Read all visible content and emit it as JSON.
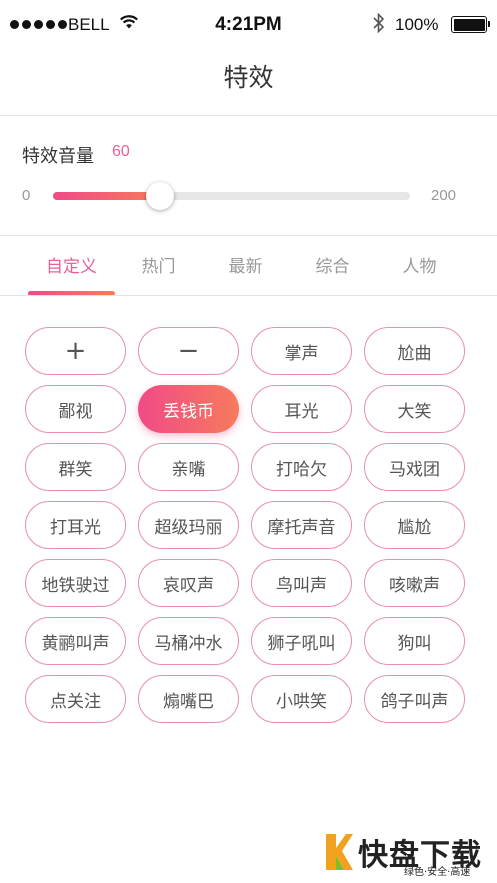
{
  "status_bar": {
    "carrier": "BELL",
    "time": "4:21PM",
    "battery": "100%",
    "signal_bars": 5
  },
  "nav": {
    "title": "特效"
  },
  "volume": {
    "label": "特效音量",
    "value": "60",
    "min": "0",
    "max": "200",
    "level": 60,
    "range_max": 200
  },
  "tabs": [
    {
      "label": "自定义",
      "active": true
    },
    {
      "label": "热门",
      "active": false
    },
    {
      "label": "最新",
      "active": false
    },
    {
      "label": "综合",
      "active": false
    },
    {
      "label": "人物",
      "active": false
    }
  ],
  "effects": [
    {
      "label": "+",
      "kind": "add"
    },
    {
      "label": "−",
      "kind": "remove"
    },
    {
      "label": "掌声"
    },
    {
      "label": "尬曲"
    },
    {
      "label": "鄙视"
    },
    {
      "label": "丢钱币",
      "selected": true
    },
    {
      "label": "耳光"
    },
    {
      "label": "大笑"
    },
    {
      "label": "群笑"
    },
    {
      "label": "亲嘴"
    },
    {
      "label": "打哈欠"
    },
    {
      "label": "马戏团"
    },
    {
      "label": "打耳光"
    },
    {
      "label": "超级玛丽"
    },
    {
      "label": "摩托声音"
    },
    {
      "label": "尴尬"
    },
    {
      "label": "地铁驶过"
    },
    {
      "label": "哀叹声"
    },
    {
      "label": "鸟叫声"
    },
    {
      "label": "咳嗽声"
    },
    {
      "label": "黄鹂叫声"
    },
    {
      "label": "马桶冲水"
    },
    {
      "label": "狮子吼叫"
    },
    {
      "label": "狗叫"
    },
    {
      "label": "点关注"
    },
    {
      "label": "煽嘴巴"
    },
    {
      "label": "小哄笑"
    },
    {
      "label": "鸽子叫声"
    }
  ],
  "watermark": {
    "brand": "快盘下载",
    "tagline": "绿色·安全·高速"
  },
  "colors": {
    "accent": "#e8609a",
    "gradient_start": "#f04a88",
    "gradient_end": "#f77b5c",
    "chip_border": "#e68fa8"
  }
}
